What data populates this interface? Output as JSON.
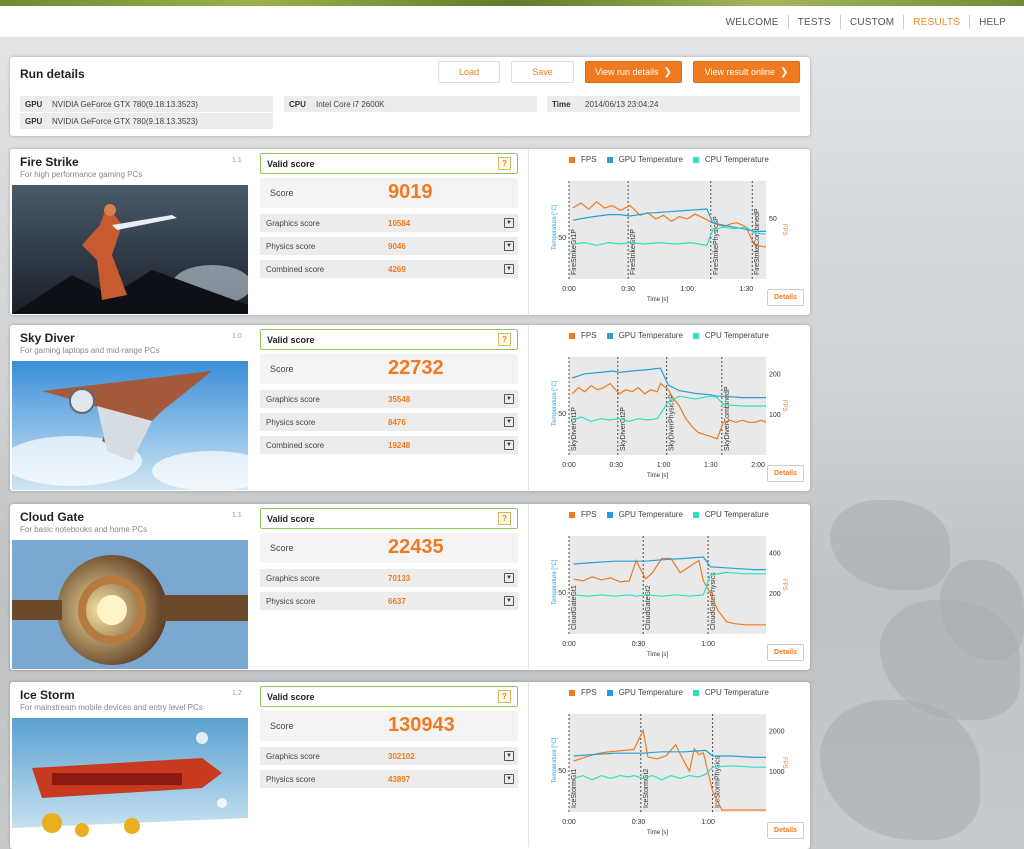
{
  "nav": {
    "items": [
      "WELCOME",
      "TESTS",
      "CUSTOM",
      "RESULTS",
      "HELP"
    ],
    "active": "RESULTS"
  },
  "run_details": {
    "title": "Run details",
    "buttons": {
      "load": "Load",
      "save": "Save",
      "view_run_details": "View run details",
      "view_result_online": "View result online"
    },
    "rows": [
      {
        "label": "GPU",
        "value": "NVIDIA GeForce GTX 780(9.18.13.3523)"
      },
      {
        "label": "GPU",
        "value": "NVIDIA GeForce GTX 780(9.18.13.3523)"
      },
      {
        "label": "CPU",
        "value": "Intel Core i7 2600K"
      },
      {
        "label": "Time",
        "value": "2014/06/13 23:04:24"
      }
    ]
  },
  "colors": {
    "accent": "#f07a20",
    "fps": "#f07a20",
    "gpu": "#2a9fd6",
    "cpu": "#2ee0c0",
    "valid_border": "#8fc85a"
  },
  "legend": {
    "fps": "FPS",
    "gpu": "GPU Temperature",
    "cpu": "CPU Temperature"
  },
  "labels": {
    "valid": "Valid score",
    "score": "Score",
    "help": "?",
    "details": "Details",
    "time_axis": "Time [s]",
    "temp_axis": "Temperature [°C]",
    "fps_axis": "FPS"
  },
  "tests": [
    {
      "name": "Fire Strike",
      "subtitle": "For high performance gaming PCs",
      "version": "1.1",
      "score": "9019",
      "subscores": [
        {
          "label": "Graphics score",
          "value": "10584"
        },
        {
          "label": "Physics score",
          "value": "9046"
        },
        {
          "label": "Combined score",
          "value": "4269"
        }
      ]
    },
    {
      "name": "Sky Diver",
      "subtitle": "For gaming laptops and mid-range PCs",
      "version": "1.0",
      "score": "22732",
      "subscores": [
        {
          "label": "Graphics score",
          "value": "35548"
        },
        {
          "label": "Physics score",
          "value": "8476"
        },
        {
          "label": "Combined score",
          "value": "19248"
        }
      ]
    },
    {
      "name": "Cloud Gate",
      "subtitle": "For basic notebooks and home PCs",
      "version": "1.1",
      "score": "22435",
      "subscores": [
        {
          "label": "Graphics score",
          "value": "70133"
        },
        {
          "label": "Physics score",
          "value": "6637"
        }
      ]
    },
    {
      "name": "Ice Storm",
      "subtitle": "For mainstream mobile devices and entry level PCs",
      "version": "1.2",
      "score": "130943",
      "subscores": [
        {
          "label": "Graphics score",
          "value": "302102"
        },
        {
          "label": "Physics score",
          "value": "43897"
        }
      ]
    }
  ],
  "chart_data": [
    {
      "type": "line",
      "xlabel": "Time [s]",
      "ylabel": "Temperature [°C]",
      "y2label": "FPS",
      "x_ticks": [
        "0:00",
        "0:30",
        "1:00",
        "1:30"
      ],
      "xlim": [
        0,
        100
      ],
      "y_ticks": [
        50
      ],
      "y2_ticks": [
        50
      ],
      "segments": [
        "FireStrikeGt1P",
        "FireStrikeGt2P",
        "FireStrikePhysicsP",
        "FireStrikeCombinedP"
      ],
      "segment_bounds": [
        [
          0,
          27
        ],
        [
          30,
          70
        ],
        [
          72,
          91
        ],
        [
          93,
          100
        ]
      ],
      "series": [
        {
          "name": "FPS",
          "x": [
            2,
            6,
            10,
            14,
            18,
            22,
            26,
            31,
            36,
            40,
            44,
            48,
            52,
            56,
            60,
            64,
            68,
            73,
            76,
            79,
            82,
            85,
            88,
            90,
            94,
            97,
            100
          ],
          "values": [
            58,
            62,
            57,
            63,
            58,
            60,
            56,
            60,
            52,
            54,
            49,
            52,
            47,
            51,
            49,
            53,
            50,
            46,
            44,
            43,
            45,
            46,
            44,
            42,
            28,
            27,
            26
          ]
        },
        {
          "name": "GPU Temperature",
          "x": [
            2,
            10,
            20,
            26,
            31,
            40,
            50,
            60,
            70,
            73,
            80,
            88,
            91,
            94,
            100
          ],
          "values": [
            62,
            64,
            66,
            66,
            65,
            67,
            68,
            69,
            70,
            60,
            58,
            56,
            55,
            54,
            54
          ]
        },
        {
          "name": "CPU Temperature",
          "x": [
            2,
            8,
            14,
            20,
            26,
            31,
            38,
            46,
            54,
            62,
            70,
            73,
            78,
            84,
            90,
            94,
            100
          ],
          "values": [
            45,
            46,
            44,
            46,
            45,
            46,
            45,
            46,
            45,
            46,
            44,
            55,
            57,
            56,
            57,
            53,
            52
          ]
        }
      ]
    },
    {
      "type": "line",
      "xlabel": "Time [s]",
      "ylabel": "Temperature [°C]",
      "y2label": "FPS",
      "x_ticks": [
        "0:00",
        "0:30",
        "1:00",
        "1:30",
        "2:00"
      ],
      "xlim": [
        0,
        125
      ],
      "y_ticks": [
        50
      ],
      "y2_ticks": [
        100,
        200
      ],
      "segments": [
        "SkyDiverGt1P",
        "SkyDiverGt2P",
        "SkyDiverPhysicsP",
        "SkyDiverCombinedP"
      ],
      "segment_bounds": [
        [
          0,
          28
        ],
        [
          31,
          59
        ],
        [
          62,
          94
        ],
        [
          97,
          125
        ]
      ],
      "series": [
        {
          "name": "FPS",
          "x": [
            2,
            6,
            10,
            14,
            18,
            22,
            26,
            32,
            36,
            40,
            44,
            48,
            52,
            56,
            58,
            63,
            66,
            70,
            74,
            78,
            82,
            86,
            90,
            94,
            98,
            102,
            106,
            110,
            114,
            118,
            122,
            125
          ],
          "values": [
            150,
            165,
            155,
            170,
            160,
            165,
            175,
            150,
            160,
            155,
            165,
            150,
            160,
            155,
            175,
            160,
            140,
            120,
            90,
            70,
            55,
            50,
            45,
            40,
            80,
            85,
            80,
            85,
            80,
            80,
            85,
            80
          ]
        },
        {
          "name": "GPU Temperature",
          "x": [
            2,
            10,
            20,
            28,
            32,
            40,
            50,
            58,
            63,
            70,
            80,
            90,
            94,
            98,
            110,
            125
          ],
          "values": [
            75,
            78,
            79,
            80,
            79,
            80,
            81,
            82,
            70,
            66,
            64,
            63,
            62,
            62,
            61,
            61
          ]
        },
        {
          "name": "CPU Temperature",
          "x": [
            2,
            8,
            14,
            20,
            26,
            32,
            38,
            44,
            50,
            56,
            63,
            70,
            80,
            90,
            94,
            98,
            110,
            125
          ],
          "values": [
            45,
            47,
            44,
            46,
            45,
            46,
            44,
            46,
            45,
            46,
            58,
            62,
            60,
            62,
            61,
            56,
            55,
            55
          ]
        }
      ]
    },
    {
      "type": "line",
      "xlabel": "Time [s]",
      "ylabel": "Temperature [°C]",
      "y2label": "FPS",
      "x_ticks": [
        "0:00",
        "0:30",
        "1:00"
      ],
      "xlim": [
        0,
        85
      ],
      "y_ticks": [
        50
      ],
      "y2_ticks": [
        200,
        400
      ],
      "segments": [
        "CloudGateGt1",
        "CloudGateGt2",
        "CloudGatePhysics"
      ],
      "segment_bounds": [
        [
          0,
          29
        ],
        [
          32,
          57
        ],
        [
          60,
          85
        ]
      ],
      "series": [
        {
          "name": "FPS",
          "x": [
            2,
            6,
            10,
            14,
            18,
            22,
            26,
            29,
            33,
            36,
            40,
            44,
            48,
            52,
            56,
            58,
            61,
            64,
            68,
            72,
            76,
            80,
            85
          ],
          "values": [
            270,
            260,
            280,
            265,
            275,
            255,
            260,
            360,
            270,
            300,
            370,
            370,
            300,
            330,
            360,
            260,
            200,
            120,
            60,
            50,
            45,
            45,
            45
          ]
        },
        {
          "name": "GPU Temperature",
          "x": [
            2,
            10,
            20,
            29,
            33,
            40,
            50,
            58,
            61,
            70,
            80,
            85
          ],
          "values": [
            70,
            71,
            72,
            72,
            72,
            73,
            74,
            75,
            68,
            67,
            66,
            66
          ]
        },
        {
          "name": "CPU Temperature",
          "x": [
            2,
            8,
            14,
            20,
            26,
            29,
            33,
            40,
            46,
            52,
            58,
            61,
            68,
            76,
            85
          ],
          "values": [
            48,
            47,
            48,
            47,
            48,
            47,
            48,
            47,
            48,
            47,
            48,
            62,
            64,
            63,
            63
          ]
        }
      ]
    },
    {
      "type": "line",
      "xlabel": "Time [s]",
      "ylabel": "Temperature [°C]",
      "y2label": "FPS",
      "x_ticks": [
        "0:00",
        "0:30",
        "1:00"
      ],
      "xlim": [
        0,
        85
      ],
      "y_ticks": [
        50
      ],
      "y2_ticks": [
        1000,
        2000
      ],
      "segments": [
        "IceStormGt1",
        "IceStormGt2",
        "IceStormPhysics"
      ],
      "segment_bounds": [
        [
          0,
          28
        ],
        [
          31,
          59
        ],
        [
          62,
          85
        ]
      ],
      "series": [
        {
          "name": "FPS",
          "x": [
            2,
            6,
            10,
            14,
            18,
            22,
            26,
            28,
            32,
            34,
            38,
            42,
            46,
            50,
            52,
            54,
            56,
            58,
            62,
            66,
            70,
            75,
            80,
            85
          ],
          "values": [
            1250,
            1320,
            1400,
            1450,
            1480,
            1500,
            1520,
            1530,
            2000,
            1350,
            1300,
            1380,
            1650,
            1200,
            1000,
            1550,
            1400,
            1450,
            500,
            50,
            50,
            50,
            50,
            50
          ]
        },
        {
          "name": "GPU Temperature",
          "x": [
            2,
            10,
            20,
            28,
            32,
            40,
            50,
            59,
            62,
            70,
            80,
            85
          ],
          "values": [
            60,
            61,
            62,
            62,
            62,
            63,
            63,
            64,
            60,
            60,
            59,
            59
          ]
        },
        {
          "name": "CPU Temperature",
          "x": [
            2,
            6,
            10,
            14,
            18,
            22,
            26,
            28,
            32,
            36,
            40,
            44,
            48,
            52,
            56,
            59,
            62,
            70,
            80,
            85
          ],
          "values": [
            44,
            46,
            43,
            46,
            44,
            46,
            45,
            46,
            44,
            46,
            43,
            46,
            44,
            46,
            45,
            47,
            52,
            53,
            52,
            52
          ]
        }
      ]
    }
  ]
}
